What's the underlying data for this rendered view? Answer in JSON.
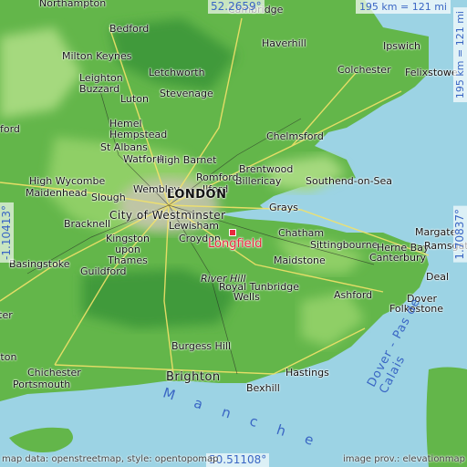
{
  "map": {
    "scale_top": "195 km = 121 mi",
    "scale_side": "195 km = 121 mi",
    "lat_top": "52.2659°",
    "lat_bottom": "50.51108°",
    "lon_left": "-1.10413°",
    "lon_right": "1.70837°",
    "attribution_left": "map data: openstreetmap, style: opentopomap",
    "attribution_right": "image prov.: elevationmap",
    "highlight": "Longfield",
    "sea_label": "M a n c h e",
    "strait_label": "Dover - Pas de Calais",
    "places": {
      "london": "LONDON",
      "westminster": "City of Westminster",
      "northampton": "Northampton",
      "bedford": "Bedford",
      "cambridge": "Cambridge",
      "haverhill": "Haverhill",
      "ipswich": "Ipswich",
      "felixstowe": "Felixstowe",
      "colchester": "Colchester",
      "milton_keynes": "Milton Keynes",
      "letchworth": "Letchworth",
      "leighton_buzzard": "Leighton Buzzard",
      "stevenage": "Stevenage",
      "luton": "Luton",
      "hemel": "Hemel Hempstead",
      "st_albans": "St Albans",
      "watford": "Watford",
      "high_barnet": "High Barnet",
      "chelmsford": "Chelmsford",
      "brentwood": "Brentwood",
      "billericay": "Billericay",
      "romford": "Romford",
      "ilford": "Ilford",
      "southend": "Southend-on-Sea",
      "high_wycombe": "High Wycombe",
      "maidenhead": "Maidenhead",
      "slough": "Slough",
      "wembley": "Wembley",
      "bracknell": "Bracknell",
      "lewisham": "Lewisham",
      "grays": "Grays",
      "chatham": "Chatham",
      "margate": "Margate",
      "sittingbourne": "Sittingbourne",
      "herne_bay": "Herne Bay",
      "ramsgate": "Ramsgate",
      "kingston": "Kingston upon Thames",
      "croydon": "Croydon",
      "basingstoke": "Basingstoke",
      "maidstone": "Maidstone",
      "canterbury": "Canterbury",
      "deal": "Deal",
      "guildford": "Guildford",
      "river_hill": "River Hill",
      "royal_tunbridge": "Royal Tunbridge",
      "wells": "Wells",
      "ashford": "Ashford",
      "dover": "Dover",
      "folkestone": "Folkestone",
      "winchester": "Winchester",
      "burgess_hill": "Burgess Hill",
      "southampton": "Southampton",
      "chichester": "Chichester",
      "portsmouth": "Portsmouth",
      "brighton": "Brighton",
      "hastings": "Hastings",
      "bexhill": "Bexhill",
      "ford": "ford"
    }
  }
}
